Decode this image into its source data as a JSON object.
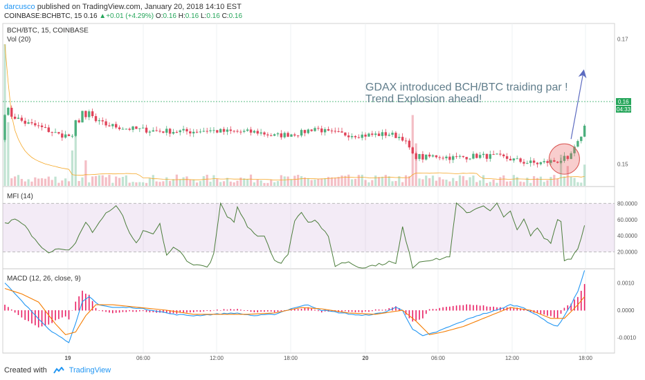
{
  "header": {
    "author": "darcusco",
    "published": "published on TradingView.com, January 20, 2018 14:10 EST",
    "symbol": "COINBASE:BCHBTC, 15",
    "last": "0.16",
    "change": "+0.01 (+4.29%)",
    "o_label": "O:",
    "o_val": "0.16",
    "h_label": "H:",
    "h_val": "0.16",
    "l_label": "L:",
    "l_val": "0.16",
    "c_label": "C:",
    "c_val": "0.16"
  },
  "footer": {
    "created_with": "Created with",
    "brand": "TradingView"
  },
  "colors": {
    "up": "#4caf7d",
    "down": "#e0445a",
    "mfi": "#4a7c3a",
    "macd": "#2196f3",
    "signal": "#f57c00",
    "hist": "#e91e63",
    "annotation": "#607d8b"
  },
  "chart_data": [
    {
      "type": "candlestick",
      "title": "BCH/BTC, 15, COINBASE",
      "volume_label": "Vol (20)",
      "annotation": [
        "GDAX introduced BCH/BTC traiding par !",
        "Trend Explosion ahead!"
      ],
      "y_ticks": [
        "0.17",
        "0.15"
      ],
      "y_tick_values": [
        0.17,
        0.15
      ],
      "ylim": [
        0.1465,
        0.1725
      ],
      "price_label": "0.16",
      "countdown": "04:33",
      "x_ticks": [
        "19",
        "06:00",
        "12:00",
        "18:00",
        "20",
        "06:00",
        "12:00",
        "18:00"
      ],
      "keypoints": [
        [
          0,
          0.1583
        ],
        [
          3,
          0.1575
        ],
        [
          6,
          0.1566
        ],
        [
          10,
          0.156
        ],
        [
          16,
          0.1547
        ],
        [
          19,
          0.1545
        ],
        [
          21,
          0.156
        ],
        [
          24,
          0.159
        ],
        [
          27,
          0.1568
        ],
        [
          30,
          0.1563
        ],
        [
          36,
          0.1557
        ],
        [
          45,
          0.1553
        ],
        [
          55,
          0.1552
        ],
        [
          60,
          0.1554
        ],
        [
          65,
          0.1552
        ],
        [
          75,
          0.1551
        ],
        [
          80,
          0.1545
        ],
        [
          88,
          0.155
        ],
        [
          92,
          0.1558
        ],
        [
          96,
          0.155
        ],
        [
          100,
          0.1548
        ],
        [
          106,
          0.1546
        ],
        [
          110,
          0.1547
        ],
        [
          114,
          0.1548
        ],
        [
          118,
          0.1542
        ],
        [
          121,
          0.1517
        ],
        [
          124,
          0.151
        ],
        [
          128,
          0.1513
        ],
        [
          133,
          0.151
        ],
        [
          140,
          0.1513
        ],
        [
          146,
          0.1512
        ],
        [
          150,
          0.1508
        ],
        [
          154,
          0.1503
        ],
        [
          158,
          0.1501
        ],
        [
          162,
          0.1504
        ],
        [
          165,
          0.1505
        ],
        [
          167,
          0.1505
        ],
        [
          168,
          0.1516
        ],
        [
          170,
          0.1533
        ],
        [
          172,
          0.156
        ]
      ],
      "events": [
        {
          "index": 1,
          "close": 0.159
        },
        {
          "index": 20,
          "close": 0.1545
        },
        {
          "index": 21,
          "close": 0.157
        },
        {
          "index": 23,
          "close": 0.1585
        },
        {
          "index": 24,
          "close": 0.1575
        },
        {
          "index": 121,
          "close": 0.1517
        },
        {
          "index": 122,
          "close": 0.1508
        },
        {
          "index": 165,
          "close": 0.1505
        },
        {
          "index": 166,
          "close": 0.1513
        },
        {
          "index": 167,
          "close": 0.1508
        }
      ],
      "volume_spikes": [
        {
          "index": 0,
          "volume": 100
        },
        {
          "index": 1,
          "volume": 45
        },
        {
          "index": 20,
          "volume": 25
        },
        {
          "index": 21,
          "volume": 38
        },
        {
          "index": 24,
          "volume": 18
        },
        {
          "index": 121,
          "volume": 50
        },
        {
          "index": 122,
          "volume": 30
        },
        {
          "index": 165,
          "volume": 22
        },
        {
          "index": 167,
          "volume": 14
        },
        {
          "index": 172,
          "volume": 15
        }
      ]
    },
    {
      "type": "line",
      "title": "MFI (14)",
      "y_ticks": [
        "80.0000",
        "60.0000",
        "40.0000",
        "20.0000"
      ],
      "y_tick_values": [
        80,
        60,
        40,
        20
      ],
      "ylim": [
        0,
        100
      ],
      "band": [
        20,
        80
      ],
      "keypoints": [
        [
          0,
          55
        ],
        [
          3,
          60
        ],
        [
          6,
          52
        ],
        [
          8,
          40
        ],
        [
          10,
          30
        ],
        [
          13,
          20
        ],
        [
          16,
          25
        ],
        [
          19,
          22
        ],
        [
          21,
          32
        ],
        [
          24,
          56
        ],
        [
          26,
          45
        ],
        [
          30,
          68
        ],
        [
          33,
          76
        ],
        [
          35,
          65
        ],
        [
          37,
          42
        ],
        [
          39,
          30
        ],
        [
          41,
          45
        ],
        [
          44,
          42
        ],
        [
          46,
          54
        ],
        [
          48,
          16
        ],
        [
          50,
          25
        ],
        [
          52,
          20
        ],
        [
          54,
          10
        ],
        [
          56,
          3
        ],
        [
          58,
          5
        ],
        [
          60,
          0
        ],
        [
          62,
          17
        ],
        [
          64,
          80
        ],
        [
          66,
          62
        ],
        [
          68,
          58
        ],
        [
          69,
          75
        ],
        [
          72,
          52
        ],
        [
          75,
          40
        ],
        [
          77,
          40
        ],
        [
          80,
          10
        ],
        [
          82,
          5
        ],
        [
          84,
          18
        ],
        [
          86,
          58
        ],
        [
          88,
          70
        ],
        [
          90,
          57
        ],
        [
          92,
          60
        ],
        [
          94,
          50
        ],
        [
          96,
          38
        ],
        [
          98,
          3
        ],
        [
          100,
          6
        ],
        [
          102,
          8
        ],
        [
          104,
          3
        ],
        [
          106,
          0
        ],
        [
          108,
          2
        ],
        [
          110,
          4
        ],
        [
          112,
          5
        ],
        [
          114,
          8
        ],
        [
          116,
          5
        ],
        [
          118,
          50
        ],
        [
          120,
          20
        ],
        [
          121,
          0
        ],
        [
          123,
          8
        ],
        [
          125,
          10
        ],
        [
          127,
          10
        ],
        [
          130,
          12
        ],
        [
          132,
          15
        ],
        [
          134,
          80
        ],
        [
          137,
          68
        ],
        [
          140,
          74
        ],
        [
          142,
          78
        ],
        [
          144,
          70
        ],
        [
          146,
          80
        ],
        [
          148,
          62
        ],
        [
          150,
          72
        ],
        [
          152,
          46
        ],
        [
          154,
          60
        ],
        [
          156,
          40
        ],
        [
          158,
          50
        ],
        [
          160,
          38
        ],
        [
          162,
          32
        ],
        [
          164,
          60
        ],
        [
          165,
          58
        ],
        [
          166,
          10
        ],
        [
          168,
          12
        ],
        [
          170,
          25
        ],
        [
          172,
          52
        ]
      ]
    },
    {
      "type": "line",
      "title": "MACD (12, 26, close, 9)",
      "y_ticks": [
        "0.0010",
        "0.0000",
        "-0.0010"
      ],
      "y_tick_values": [
        0.001,
        0,
        -0.001
      ],
      "ylim": [
        -0.00155,
        0.0015
      ],
      "series": [
        {
          "role": "macd",
          "keypoints": [
            [
              0,
              0.001
            ],
            [
              3,
              0.0006
            ],
            [
              6,
              0.0002
            ],
            [
              10,
              -0.0003
            ],
            [
              14,
              -0.0008
            ],
            [
              17,
              -0.001
            ],
            [
              19,
              -0.0012
            ],
            [
              21,
              -0.0005
            ],
            [
              23,
              0.0003
            ],
            [
              25,
              0.0005
            ],
            [
              28,
              0.0002
            ],
            [
              32,
              0.0001
            ],
            [
              38,
              0.0001
            ],
            [
              44,
              0
            ],
            [
              50,
              -0.00015
            ],
            [
              56,
              -0.0002
            ],
            [
              62,
              -0.00015
            ],
            [
              68,
              -0.0001
            ],
            [
              74,
              -0.0002
            ],
            [
              80,
              -0.00015
            ],
            [
              86,
              0.0001
            ],
            [
              90,
              0.0002
            ],
            [
              94,
              0
            ],
            [
              100,
              -0.0001
            ],
            [
              106,
              -0.0002
            ],
            [
              112,
              -0.0001
            ],
            [
              116,
              0.0001
            ],
            [
              118,
              0
            ],
            [
              121,
              -0.0007
            ],
            [
              124,
              -0.00095
            ],
            [
              128,
              -0.0008
            ],
            [
              134,
              -0.0005
            ],
            [
              140,
              -0.0002
            ],
            [
              146,
              0
            ],
            [
              150,
              0.0002
            ],
            [
              154,
              0.0001
            ],
            [
              158,
              -0.0002
            ],
            [
              162,
              -0.0005
            ],
            [
              164,
              -0.0006
            ],
            [
              166,
              -0.0002
            ],
            [
              168,
              0.0002
            ],
            [
              170,
              0.0007
            ],
            [
              172,
              0.00145
            ]
          ]
        },
        {
          "role": "signal",
          "keypoints": [
            [
              0,
              0.0008
            ],
            [
              5,
              0.0006
            ],
            [
              10,
              0.0003
            ],
            [
              15,
              -0.0005
            ],
            [
              18,
              -0.0009
            ],
            [
              21,
              -0.0008
            ],
            [
              24,
              -0.0002
            ],
            [
              27,
              0.0002
            ],
            [
              32,
              0.0002
            ],
            [
              40,
              0.0001
            ],
            [
              48,
              0
            ],
            [
              56,
              -0.00015
            ],
            [
              64,
              -0.00015
            ],
            [
              72,
              -0.00015
            ],
            [
              80,
              -0.0001
            ],
            [
              88,
              0.0001
            ],
            [
              94,
              5e-05
            ],
            [
              102,
              -0.0001
            ],
            [
              110,
              -0.00015
            ],
            [
              118,
              0
            ],
            [
              122,
              -0.0004
            ],
            [
              126,
              -0.0009
            ],
            [
              130,
              -0.0008
            ],
            [
              136,
              -0.0006
            ],
            [
              144,
              -0.0002
            ],
            [
              150,
              0.0001
            ],
            [
              156,
              0
            ],
            [
              162,
              -0.0003
            ],
            [
              166,
              -0.0003
            ],
            [
              170,
              0.0002
            ],
            [
              172,
              0.0005
            ]
          ]
        }
      ]
    }
  ]
}
